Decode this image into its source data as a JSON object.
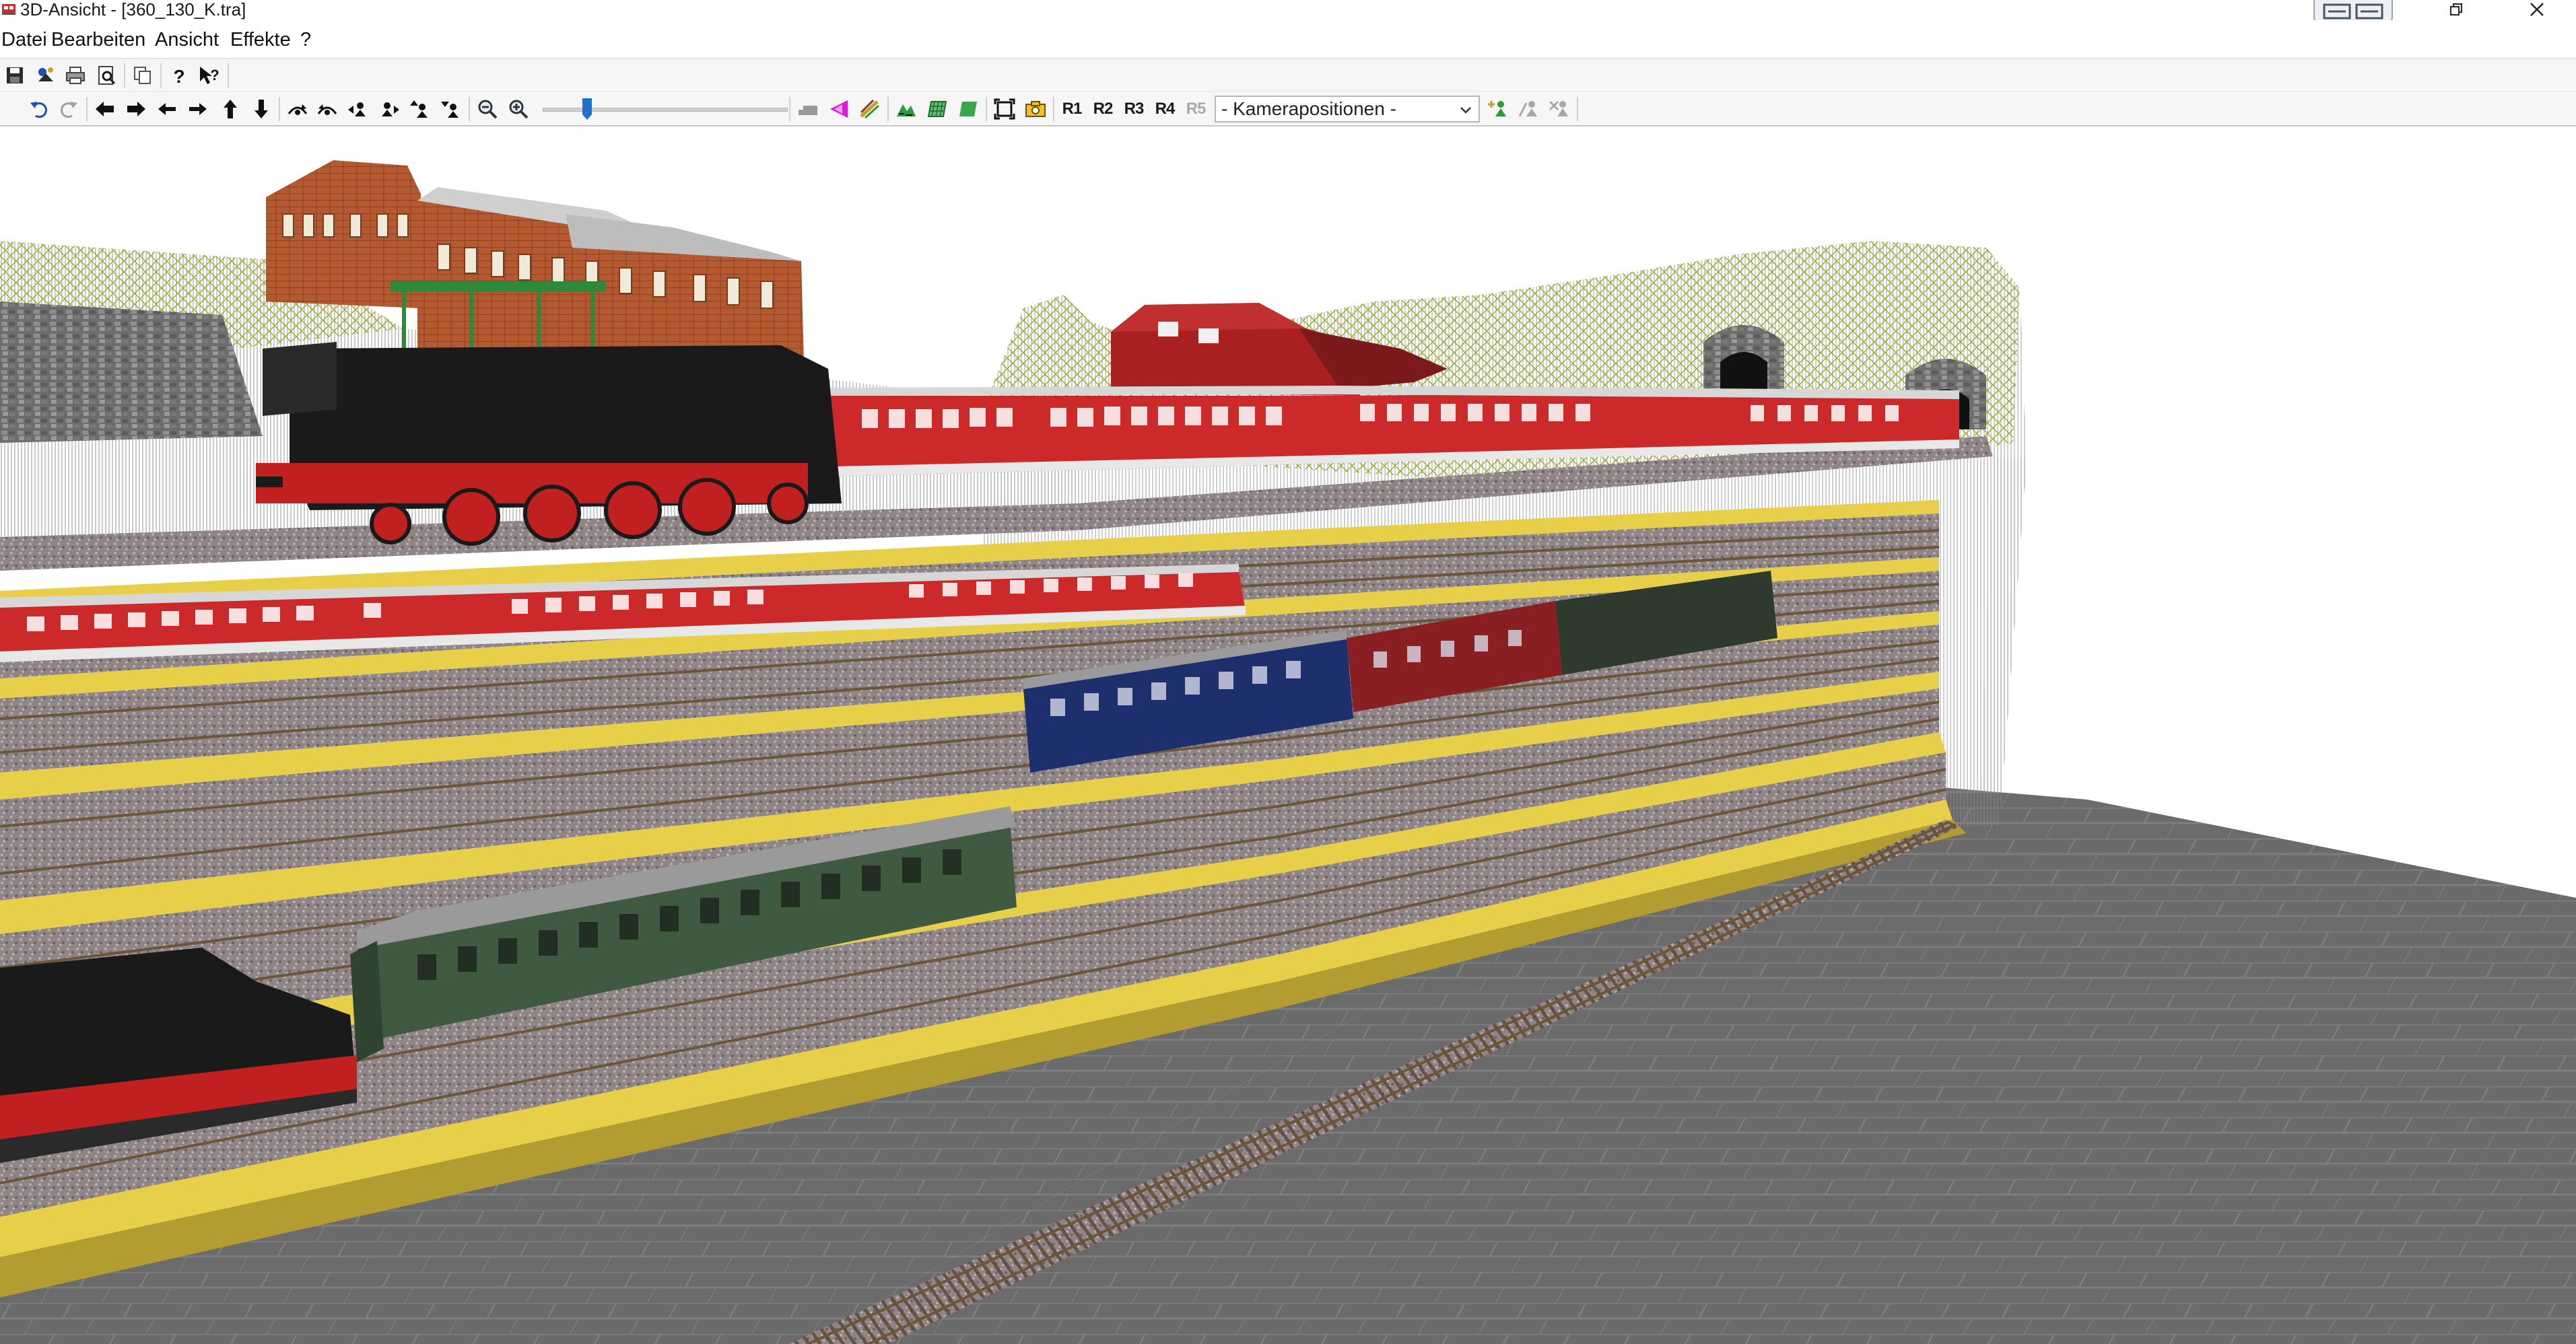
{
  "window": {
    "title": "3D-Ansicht - [360_130_K.tra]"
  },
  "menu": {
    "items": [
      "Datei",
      "Bearbeiten",
      "Ansicht",
      "Effekte",
      "?"
    ]
  },
  "toolbar1": {
    "icons": [
      "save-icon",
      "train-settings-icon",
      "print-icon",
      "print-preview-icon",
      "copy-icon",
      "help-icon",
      "context-help-icon"
    ]
  },
  "toolbar2": {
    "icons": [
      "undo-icon",
      "redo-icon",
      "arrow-left-icon",
      "arrow-right-icon",
      "move-left-icon",
      "move-right-icon",
      "move-up-icon",
      "move-down-icon",
      "camera-forward-icon",
      "camera-back-icon",
      "camera-turn-left-icon",
      "camera-turn-right-icon",
      "camera-raise-icon",
      "camera-lower-icon",
      "zoom-out-icon",
      "zoom-in-icon",
      "terrain-flat-icon",
      "magenta-marker-icon",
      "track-edit-icon",
      "landscape-icon",
      "grid-icon",
      "texture-icon",
      "fit-view-icon",
      "screenshot-icon",
      "camera-position-icon"
    ],
    "recorded_positions": [
      "R1",
      "R2",
      "R3",
      "R4",
      "R5"
    ],
    "camera_positions_select": "- Kamerapositionen -",
    "zoom_level": 0.18,
    "colors": {
      "accent_blue": "#1f6fd0",
      "magenta": "#d81bd8",
      "green": "#2a9a3a"
    }
  },
  "scene": {
    "colors": {
      "background": "#ffffff",
      "floor_tiles": "#6b6b6b",
      "platform_yellow": "#e8cf49",
      "ballast": "#8f8486",
      "rail": "#6b5638",
      "train_red": "#cc2a2a",
      "wagon_green": "#3f5a40",
      "wagon_blue": "#1e2f6e",
      "wagon_darkred": "#8a1f22",
      "locomotive": "#1a1a1a",
      "wire_green": "#9aac2a",
      "building_brick": "#b45a32",
      "bridge_blue": "#3d7fc0"
    }
  }
}
